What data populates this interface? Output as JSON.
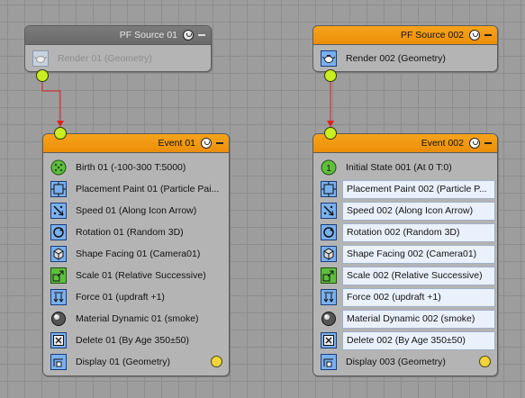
{
  "sources": [
    {
      "title": "PF Source 01",
      "style": "disabled",
      "operator": "Render 01 (Geometry)",
      "operator_icon": "render-teapot-icon"
    },
    {
      "title": "PF Source 002",
      "style": "active",
      "operator": "Render 002 (Geometry)",
      "operator_icon": "render-teapot-icon"
    }
  ],
  "events": [
    {
      "title": "Event 01",
      "operators": [
        {
          "label": "Birth 01 (-100-300 T:5000)",
          "icon": "birth-icon"
        },
        {
          "label": "Placement Paint 01 (Particle Pai...",
          "icon": "placement-paint-icon"
        },
        {
          "label": "Speed 01 (Along Icon Arrow)",
          "icon": "speed-icon"
        },
        {
          "label": "Rotation 01 (Random 3D)",
          "icon": "rotation-icon"
        },
        {
          "label": "Shape Facing 01 (Camera01)",
          "icon": "shape-facing-icon"
        },
        {
          "label": "Scale 01 (Relative Successive)",
          "icon": "scale-icon"
        },
        {
          "label": "Force 01 (updraft +1)",
          "icon": "force-icon"
        },
        {
          "label": "Material Dynamic 01 (smoke)",
          "icon": "material-dynamic-icon"
        },
        {
          "label": "Delete 01 (By Age 350±50)",
          "icon": "delete-icon"
        },
        {
          "label": "Display 01 (Geometry)",
          "icon": "display-icon"
        }
      ]
    },
    {
      "title": "Event 002",
      "operators": [
        {
          "label": "Initial State 001 (At 0 T:0)",
          "icon": "initial-state-icon"
        },
        {
          "label": "Placement Paint 002 (Particle P...",
          "icon": "placement-paint-icon"
        },
        {
          "label": "Speed 002 (Along Icon Arrow)",
          "icon": "speed-icon"
        },
        {
          "label": "Rotation 002 (Random 3D)",
          "icon": "rotation-icon"
        },
        {
          "label": "Shape Facing 002 (Camera01)",
          "icon": "shape-facing-icon"
        },
        {
          "label": "Scale 002 (Relative Successive)",
          "icon": "scale-icon"
        },
        {
          "label": "Force 002 (updraft +1)",
          "icon": "force-icon"
        },
        {
          "label": "Material Dynamic 002 (smoke)",
          "icon": "material-dynamic-icon"
        },
        {
          "label": "Delete 002 (By Age 350±50)",
          "icon": "delete-icon"
        },
        {
          "label": "Display 003 (Geometry)",
          "icon": "display-icon"
        }
      ]
    }
  ],
  "colors": {
    "header_active": "#f29a12",
    "header_disabled": "#737373",
    "port": "#c9ee22",
    "wire": "#e02020",
    "display_dot": "#f2d43a"
  }
}
